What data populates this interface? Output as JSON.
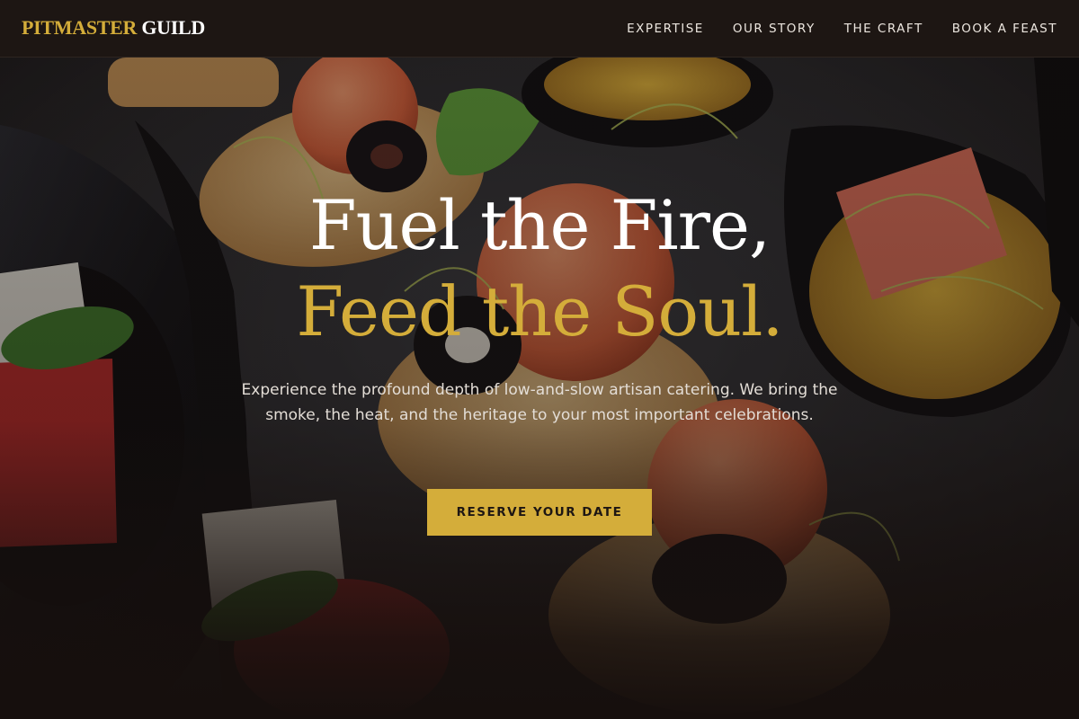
{
  "header": {
    "logo_part1": "PITMASTER",
    "logo_part2": "GUILD",
    "nav": [
      {
        "label": "EXPERTISE"
      },
      {
        "label": "OUR STORY"
      },
      {
        "label": "THE CRAFT"
      },
      {
        "label": "BOOK A FEAST"
      }
    ]
  },
  "hero": {
    "headline_line1": "Fuel the Fire,",
    "headline_line2": "Feed the Soul.",
    "subtext": "Experience the profound depth of low-and-slow artisan catering. We bring the smoke, the heat, and the heritage to your most important celebrations.",
    "cta_label": "RESERVE YOUR DATE"
  },
  "colors": {
    "accent_gold": "#d4ad3a",
    "header_bg": "#1d1613",
    "page_bg": "#140f0d"
  }
}
